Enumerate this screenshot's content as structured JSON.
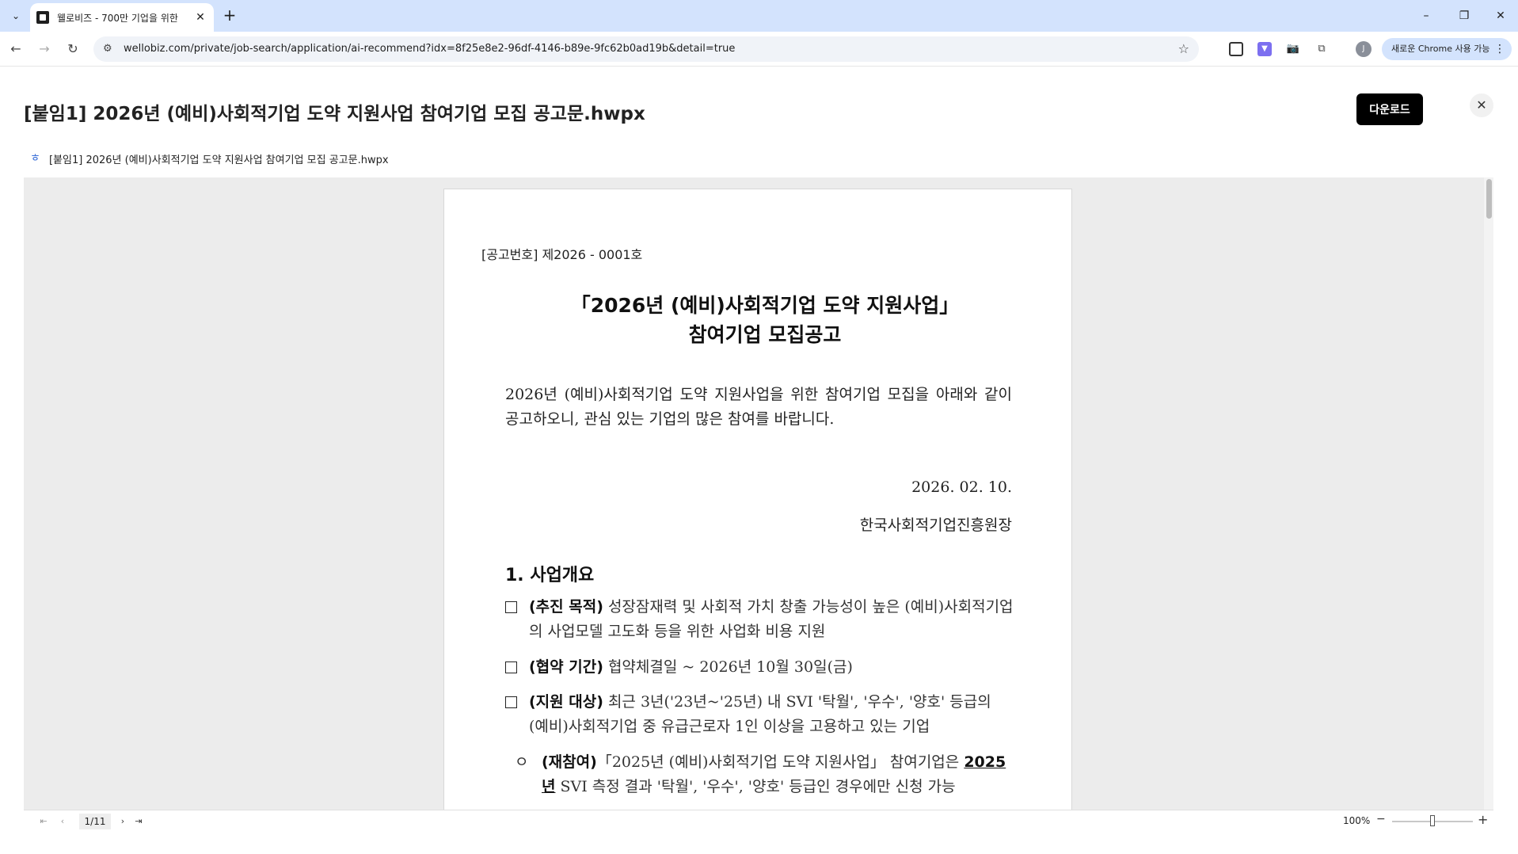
{
  "browser": {
    "tab_title": "웰로비즈 - 700만 기업을 위한",
    "url": "wellobiz.com/private/job-search/application/ai-recommend?idx=8f25e8e2-96df-4146-b89e-9fc62b0ad19b&detail=true",
    "profile_initial": "J",
    "profile_label": "새로운 Chrome 사용 가능"
  },
  "modal": {
    "title": "[붙임1] 2026년 (예비)사회적기업 도약 지원사업 참여기업 모집 공고문.hwpx",
    "download_label": "다운로드",
    "file_name": "[붙임1] 2026년 (예비)사회적기업 도약 지원사업 참여기업 모집 공고문.hwpx"
  },
  "document": {
    "notice_number": "[공고번호] 제2026 - 0001호",
    "heading_line1": "「2026년 (예비)사회적기업 도약 지원사업」",
    "heading_line2": "참여기업 모집공고",
    "intro": "2026년 (예비)사회적기업 도약 지원사업을 위한 참여기업 모집을 아래와 같이 공고하오니, 관심 있는 기업의 많은 참여를 바랍니다.",
    "date": "2026. 02. 10.",
    "issuer": "한국사회적기업진흥원장",
    "section1_title": "1. 사업개요",
    "items": [
      {
        "label": "(추진 목적)",
        "text": " 성장잠재력 및 사회적 가치 창출 가능성이 높은 (예비)사회적기업의 사업모델 고도화 등을 위한 사업화 비용 지원"
      },
      {
        "label": "(협약 기간)",
        "text": " 협약체결일 ~ 2026년 10월 30일(금)"
      },
      {
        "label": "(지원 대상)",
        "text": " 최근 3년('23년~'25년) 내 SVI '탁월', '우수', '양호' 등급의 (예비)사회적기업 중 유급근로자 1인 이상을 고용하고 있는 기업"
      }
    ],
    "sub_item": {
      "bullet": "ㅇ",
      "label": "(재참여)",
      "text_a": "「2025년 (예비)사회적기업 도약 지원사업」 참여기업은 ",
      "underlined": "2025년",
      "text_b": " SVI 측정 결과 '탁월', '우수', '양호' 등급인 경우에만 신청 가능"
    }
  },
  "viewer": {
    "page_indicator": "1/11",
    "zoom": "100%",
    "zoom_minus": "−",
    "zoom_plus": "+",
    "zoom_level": 0.5
  }
}
